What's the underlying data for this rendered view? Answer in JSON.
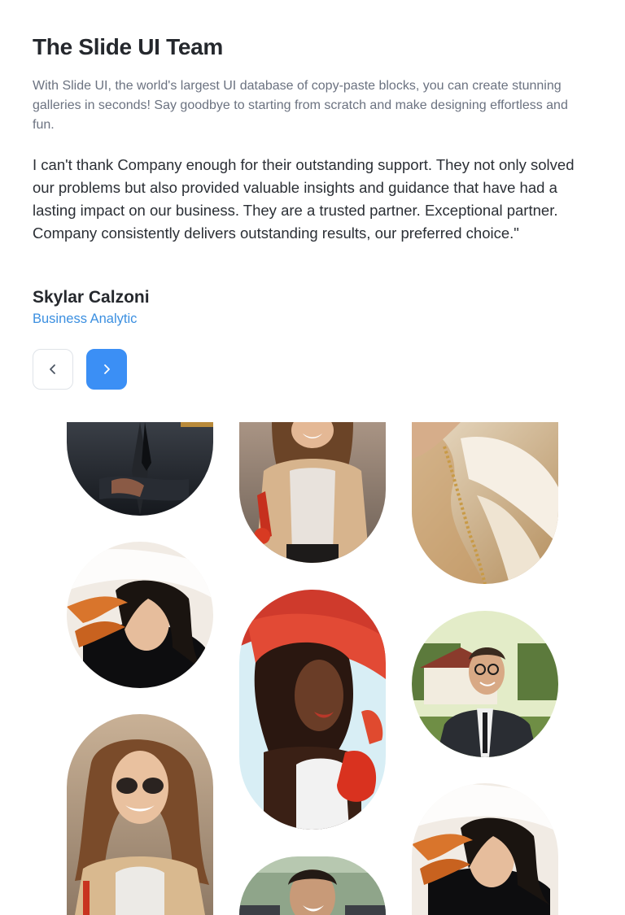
{
  "header": {
    "title": "The Slide UI Team",
    "intro": "With Slide UI, the world's largest UI database of copy-paste blocks, you can create stunning galleries in seconds! Say goodbye to starting from scratch and make designing effortless and fun."
  },
  "testimonial": {
    "quote": "I can't thank Company enough for their outstanding support. They not only solved our problems but also provided valuable insights and guidance that have had a lasting impact on our business. They are a trusted partner. Exceptional partner. Company consistently delivers outstanding results, our preferred choice.\"",
    "author_name": "Skylar Calzoni",
    "author_role": "Business Analytic"
  },
  "navigation": {
    "prev_icon": "chevron-left-icon",
    "next_icon": "chevron-right-icon"
  },
  "colors": {
    "accent": "#3b8ff5",
    "role_text": "#3b8fe0",
    "muted_text": "#6b7280",
    "border": "#dfe3e8"
  },
  "gallery": {
    "photos": [
      "man-in-suit-arms-crossed",
      "smiling-woman-with-red-bag",
      "flowing-fabric-closeup",
      "woman-with-windblown-hair",
      "woman-with-red-scarf",
      "smiling-man-with-glasses-in-front-of-house",
      "smiling-woman-with-sunglasses",
      "smiling-man-outdoors",
      "woman-with-windblown-hair-2"
    ]
  }
}
